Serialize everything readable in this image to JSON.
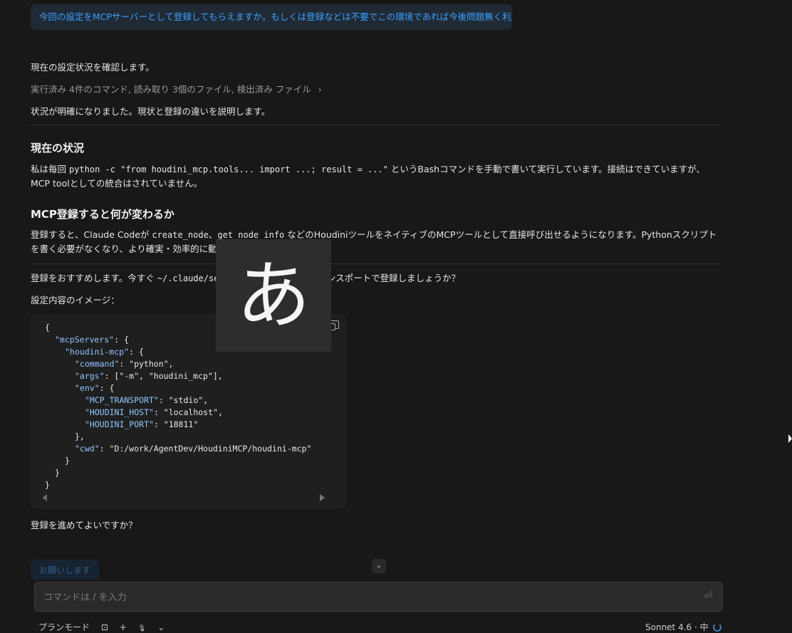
{
  "user_message": "今回の設定をMCPサーバーとして登録してもらえますか。もしくは登録などは不要でこの環境であれば今後問題無く利用できますか",
  "assistant": {
    "intro": "現在の設定状況を確認します。",
    "tool_summary": "実行済み 4件のコマンド, 読み取り 3個のファイル, 検出済み ファイル",
    "tool_chevron": "›",
    "clarified": "状況が明確になりました。現状と登録の違いを説明します。",
    "section1_title": "現在の状況",
    "section1_pre": "私は毎回 ",
    "section1_code": "python -c \"from houdini_mcp.tools... import ...; result = ...\"",
    "section1_post": " というBashコマンドを手動で書いて実行しています。接続はできていますが、MCP toolとしての統合はされていません。",
    "section2_title": "MCP登録すると何が変わるか",
    "section2_pre": "登録すると、Claude Codeが ",
    "section2_code1": "create_node",
    "section2_sep": "、",
    "section2_code2": "get_node_info",
    "section2_post": " などのHoudiniツールをネイティブのMCPツールとして直接呼び出せるようになります。Pythonスクリプトを書く必要がなくなり、より確実・効率的に動作します。",
    "recommend_pre": "登録をおすすめします。今すぐ ",
    "recommend_code": "~/.claude/settings.json",
    "recommend_post": " にstdioトランスポートで登録しましょうか？",
    "image_label": "設定内容のイメージ：",
    "closing_question": "登録を進めてよいですか？"
  },
  "code_block": {
    "lines": [
      {
        "i": 0,
        "t": "{"
      },
      {
        "i": 1,
        "k": "\"mcpServers\"",
        "t": ": {"
      },
      {
        "i": 2,
        "k": "\"houdini-mcp\"",
        "t": ": {"
      },
      {
        "i": 3,
        "k": "\"command\"",
        "t": ": \"python\","
      },
      {
        "i": 3,
        "k": "\"args\"",
        "t": ": [\"-m\", \"houdini_mcp\"],"
      },
      {
        "i": 3,
        "k": "\"env\"",
        "t": ": {"
      },
      {
        "i": 4,
        "k": "\"MCP_TRANSPORT\"",
        "t": ": \"stdio\","
      },
      {
        "i": 4,
        "k": "\"HOUDINI_HOST\"",
        "t": ": \"localhost\","
      },
      {
        "i": 4,
        "k": "\"HOUDINI_PORT\"",
        "t": ": \"18811\""
      },
      {
        "i": 3,
        "t": "},"
      },
      {
        "i": 3,
        "k": "\"cwd\"",
        "t": ": \"D:/work/AgentDev/HoudiniMCP/houdini-mcp\""
      },
      {
        "i": 2,
        "t": "}"
      },
      {
        "i": 1,
        "t": "}"
      },
      {
        "i": 0,
        "t": "}"
      }
    ]
  },
  "ime_overlay": "あ",
  "suggestion_chip": "お願いします",
  "input": {
    "placeholder": "コマンドは / を入力",
    "send_glyph": "⏎"
  },
  "footer": {
    "plan_mode": "プランモード",
    "attach_glyph": "⊡",
    "plus_glyph": "+",
    "mic_glyph": "🎙",
    "chevron": "⌄",
    "model": "Sonnet 4.6 · 中"
  },
  "scroll_down_glyph": "⌄",
  "colors": {
    "accent": "#3ea0ff",
    "background": "#181818",
    "code_bg": "#1f1f1f"
  }
}
